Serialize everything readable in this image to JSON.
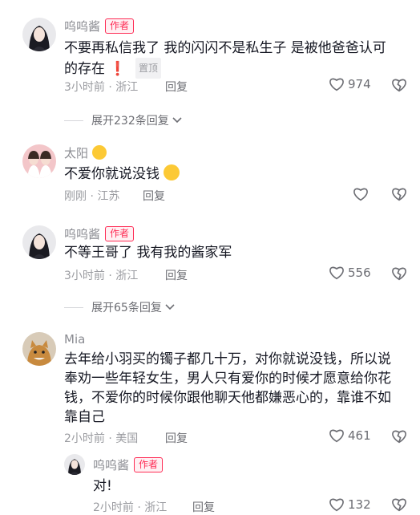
{
  "comments": [
    {
      "user": "呜呜酱",
      "tag": "作者",
      "text": "不要再私信我了 我的闪闪不是私生子 是被他爸爸认可的存在",
      "badge": "置顶",
      "time": "3小时前 · 浙江",
      "reply": "回复",
      "likes": "974",
      "expand": "展开232条回复"
    },
    {
      "user": "太阳",
      "text": "不爱你就说没钱",
      "time": "刚刚 · 江苏",
      "reply": "回复"
    },
    {
      "user": "呜呜酱",
      "tag": "作者",
      "text": "不等王哥了 我有我的酱家军",
      "time": "3小时前 · 浙江",
      "reply": "回复",
      "likes": "556",
      "expand": "展开65条回复"
    },
    {
      "user": "Mia",
      "text": "去年给小羽买的镯子都几十万，对你就说没钱，所以说奉劝一些年轻女生，男人只有爱你的时候才愿意给你花钱，不爱你的时候你跟他聊天他都嫌恶心的，靠谁不如靠自己",
      "time": "2小时前 · 美国",
      "reply": "回复",
      "likes": "461"
    },
    {
      "user": "呜呜酱",
      "tag": "作者",
      "text": "对!",
      "time": "2小时前 · 浙江",
      "reply": "回复",
      "likes": "132"
    }
  ],
  "icons": {
    "like": "heart-icon",
    "dislike": "broken-heart-icon",
    "expand": "chevron-down-icon"
  },
  "colors": {
    "author_tag": "#fe2c55",
    "text": "#161823",
    "meta": "#9b9ca1"
  }
}
